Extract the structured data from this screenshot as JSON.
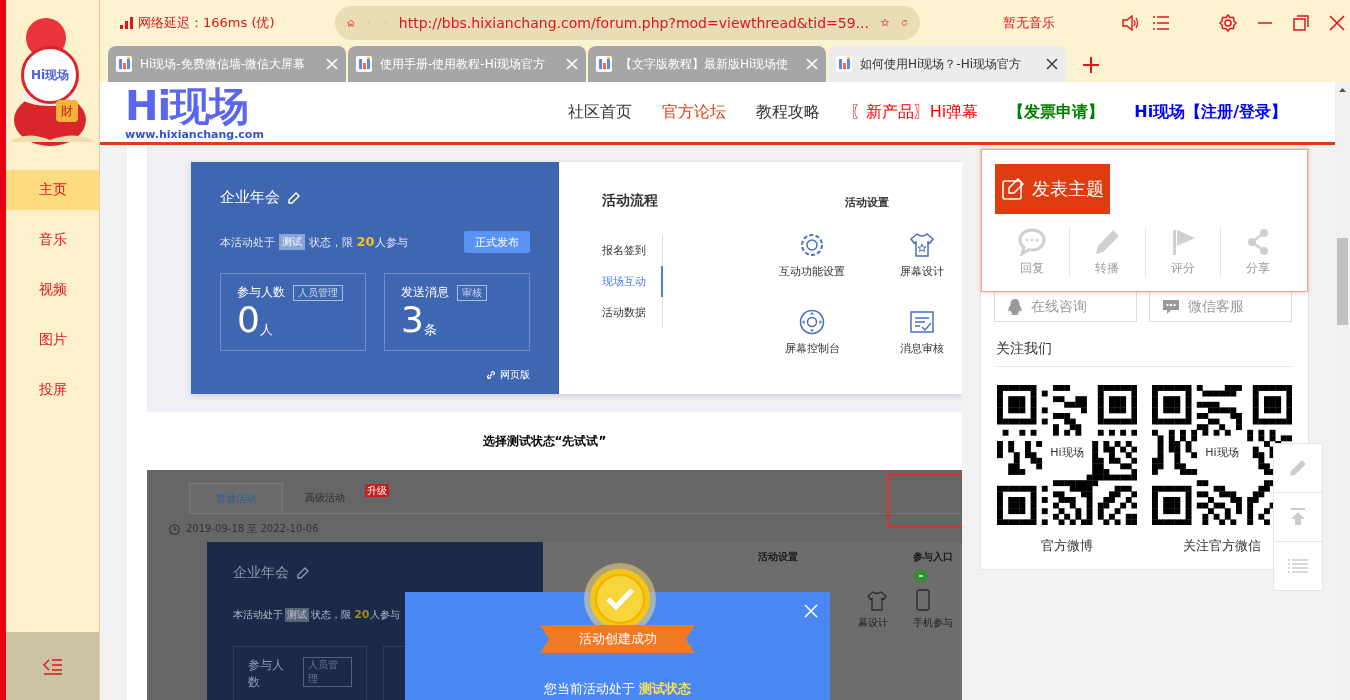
{
  "browser": {
    "network": "网络延迟：166ms (优)",
    "url": "http://bbs.hixianchang.com/forum.php?mod=viewthread&tid=59...",
    "music": "暂无音乐",
    "tabs": [
      {
        "title": "Hi现场-免费微信墙-微信大屏幕",
        "selected": false
      },
      {
        "title": "使用手册-使用教程-Hi现场官方",
        "selected": false
      },
      {
        "title": "【文字版教程】最新版Hi现场使",
        "selected": false
      },
      {
        "title": "如何使用Hi现场？-Hi现场官方",
        "selected": true
      }
    ]
  },
  "sidebar": {
    "mascot_logo": "Hi现场",
    "mascot_badge": "財",
    "items": [
      {
        "label": "主页",
        "selected": true
      },
      {
        "label": "音乐",
        "selected": false
      },
      {
        "label": "视频",
        "selected": false
      },
      {
        "label": "图片",
        "selected": false
      },
      {
        "label": "投屏",
        "selected": false
      }
    ]
  },
  "site": {
    "logo": "Hi现场",
    "logo_url": "www.hixianchang.com",
    "nav": [
      {
        "label": "社区首页",
        "color": "#333333",
        "bold": false
      },
      {
        "label": "官方论坛",
        "color": "#e03c10",
        "bold": false
      },
      {
        "label": "教程攻略",
        "color": "#333333",
        "bold": false
      },
      {
        "label": "〖新产品〗Hi弹幕",
        "color": "#ff0000",
        "bold": false
      },
      {
        "label": "【发票申请】",
        "color": "#008000",
        "bold": true
      },
      {
        "label": "Hi现场【注册/登录】",
        "color": "#0000ff",
        "bold": true
      }
    ]
  },
  "post": {
    "shot1": {
      "title": "企业年会",
      "status_prefix": "本活动处于",
      "status_tag": "测试",
      "status_suffix": "状态，限 **20**人参与",
      "publish_button": "正式发布",
      "stats": [
        {
          "label": "参与人数",
          "tag": "人员管理",
          "value": "0",
          "unit": "人"
        },
        {
          "label": "发送消息",
          "tag": "审核",
          "value": "3",
          "unit": "条"
        }
      ],
      "web_link": "网页版",
      "flow_title": "活动流程",
      "flow_steps": [
        {
          "label": "报名签到",
          "selected": false
        },
        {
          "label": "现场互动",
          "selected": true
        },
        {
          "label": "活动数据",
          "selected": false
        }
      ],
      "settings_title": "活动设置",
      "settings": [
        {
          "label": "互动功能设置",
          "kind": "gear"
        },
        {
          "label": "屏幕设计",
          "kind": "shirt"
        },
        {
          "label": "屏幕控制台",
          "kind": "dpad"
        },
        {
          "label": "消息审核",
          "kind": "checklist"
        }
      ]
    },
    "caption": "选择测试状态“先试试”",
    "shot2": {
      "tabs": [
        {
          "label": "普通活动",
          "selected": true
        },
        {
          "label": "高级活动",
          "selected": false,
          "badge": "升级"
        }
      ],
      "date": "2019-09-18 至 2022-10-06",
      "title": "企业年会",
      "status_prefix": "本活动处于",
      "status_tag": "测试",
      "status_suffix": "状态，限 **20**人参与",
      "stat_label": "参与人数",
      "stat_tag": "人员管理",
      "settings_title": "活动设置",
      "settings_item": "幕设计",
      "entry_title": "参与入口",
      "entry_item": "手机参与",
      "modal": {
        "ribbon": "活动创建成功",
        "message": "您当前活动处于 **测试状态**"
      }
    }
  },
  "side_panel": {
    "post_button": "发表主题",
    "actions": [
      {
        "label": "回复",
        "kind": "reply",
        "disabled": true
      },
      {
        "label": "转播",
        "kind": "pencil",
        "disabled": true
      },
      {
        "label": "评分",
        "kind": "flag",
        "disabled": true
      },
      {
        "label": "分享",
        "kind": "share",
        "disabled": true
      }
    ],
    "contact": [
      {
        "label": "在线咨询",
        "kind": "penguin"
      },
      {
        "label": "微信客服",
        "kind": "chat"
      }
    ],
    "follow_title": "关注我们",
    "qr": [
      {
        "label": "官方微博",
        "logo": "Hi现场"
      },
      {
        "label": "关注官方微信",
        "logo": "Hi现场"
      }
    ]
  }
}
